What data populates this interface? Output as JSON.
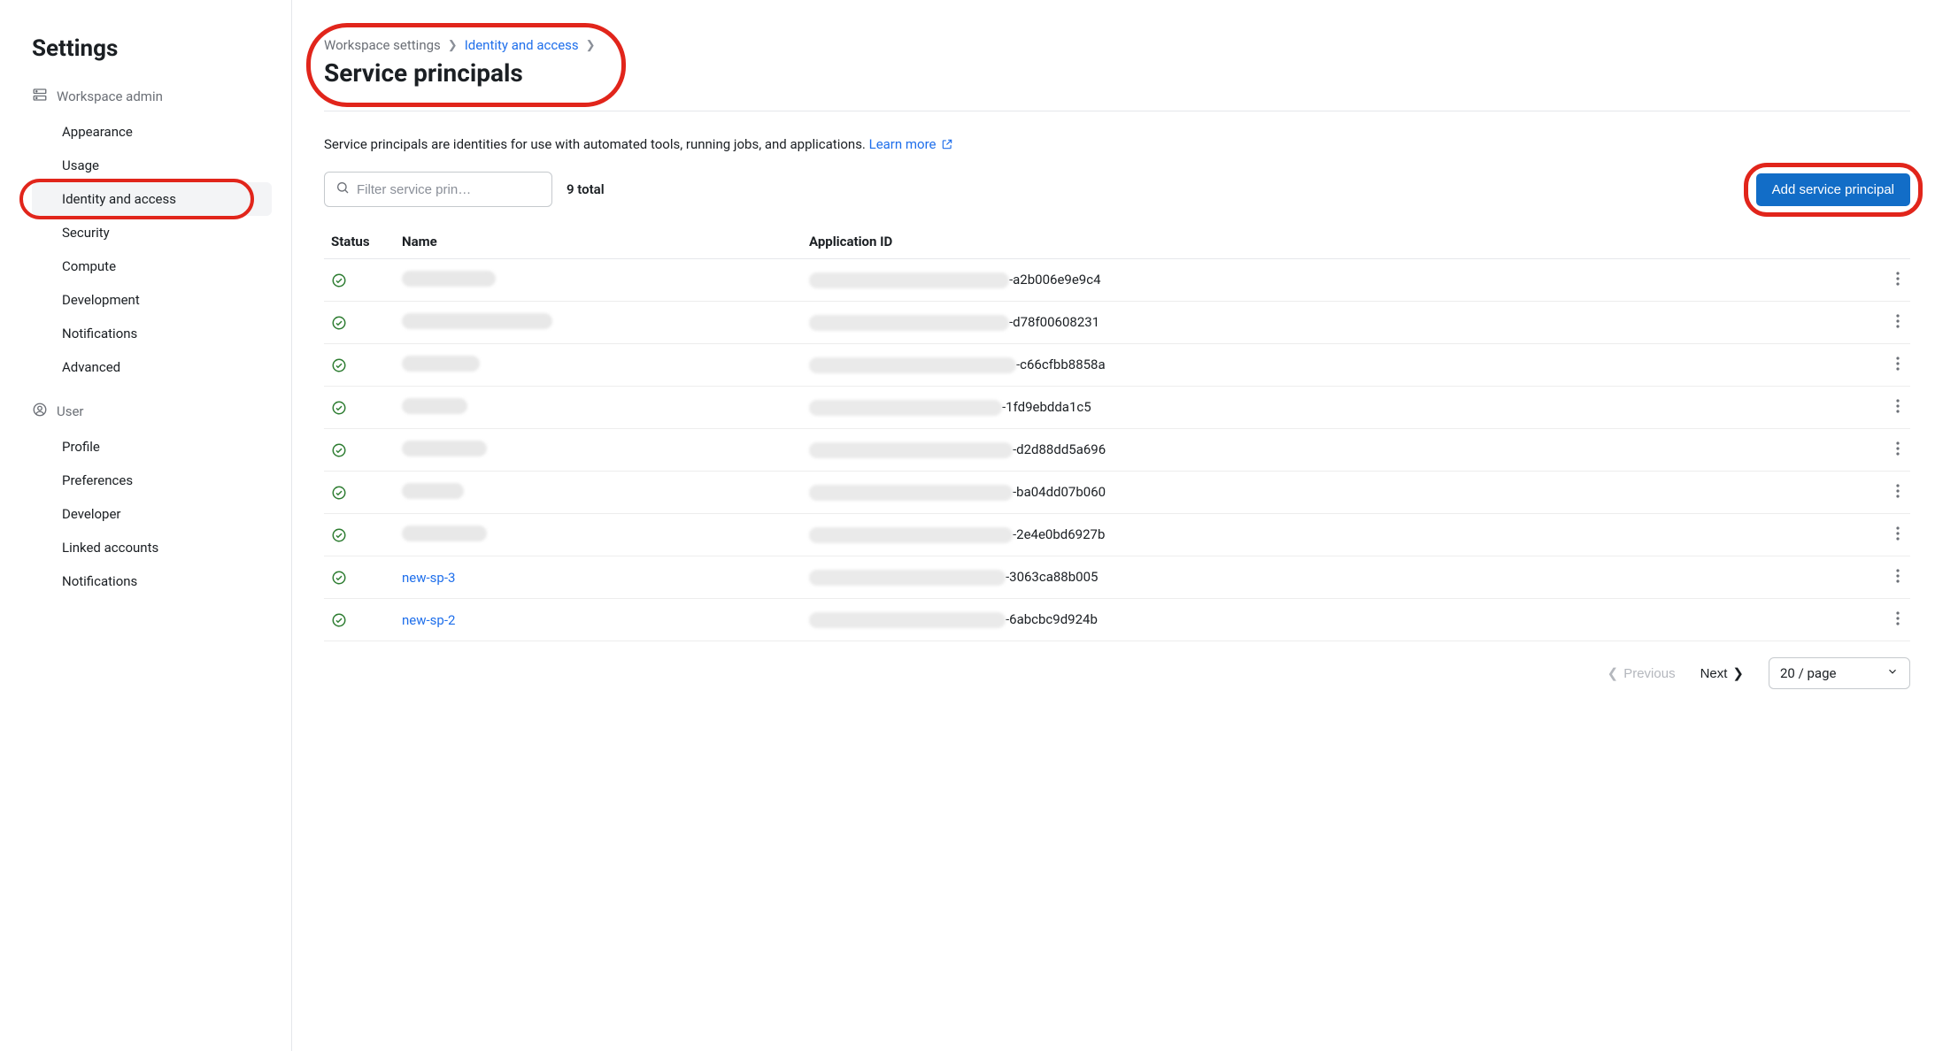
{
  "sidebar": {
    "title": "Settings",
    "sections": [
      {
        "header": "Workspace admin",
        "items": [
          {
            "label": "Appearance"
          },
          {
            "label": "Usage"
          },
          {
            "label": "Identity and access",
            "active": true,
            "highlighted": true
          },
          {
            "label": "Security"
          },
          {
            "label": "Compute"
          },
          {
            "label": "Development"
          },
          {
            "label": "Notifications"
          },
          {
            "label": "Advanced"
          }
        ]
      },
      {
        "header": "User",
        "items": [
          {
            "label": "Profile"
          },
          {
            "label": "Preferences"
          },
          {
            "label": "Developer"
          },
          {
            "label": "Linked accounts"
          },
          {
            "label": "Notifications"
          }
        ]
      }
    ]
  },
  "breadcrumb": {
    "item0": "Workspace settings",
    "item1": "Identity and access"
  },
  "page_title": "Service principals",
  "description": {
    "text": "Service principals are identities for use with automated tools, running jobs, and applications. ",
    "learn_more": "Learn more"
  },
  "filter": {
    "placeholder": "Filter service prin…"
  },
  "count_label": "9 total",
  "add_button_label": "Add service principal",
  "columns": {
    "status": "Status",
    "name": "Name",
    "appid": "Application ID"
  },
  "rows": [
    {
      "name": "",
      "name_blur_w": 106,
      "appid_blur_w": 226,
      "appid_suffix": "-a2b006e9e9c4"
    },
    {
      "name": "",
      "name_blur_w": 170,
      "appid_blur_w": 226,
      "appid_suffix": "-d78f00608231"
    },
    {
      "name": "",
      "name_blur_w": 88,
      "appid_blur_w": 234,
      "appid_suffix": "-c66cfbb8858a"
    },
    {
      "name": "",
      "name_blur_w": 74,
      "appid_blur_w": 218,
      "appid_suffix": "-1fd9ebdda1c5"
    },
    {
      "name": "",
      "name_blur_w": 96,
      "appid_blur_w": 230,
      "appid_suffix": "-d2d88dd5a696"
    },
    {
      "name": "",
      "name_blur_w": 70,
      "appid_blur_w": 230,
      "appid_suffix": "-ba04dd07b060"
    },
    {
      "name": "",
      "name_blur_w": 96,
      "appid_blur_w": 230,
      "appid_suffix": "-2e4e0bd6927b"
    },
    {
      "name": "new-sp-3",
      "name_blur_w": 0,
      "appid_blur_w": 222,
      "appid_suffix": "-3063ca88b005"
    },
    {
      "name": "new-sp-2",
      "name_blur_w": 0,
      "appid_blur_w": 222,
      "appid_suffix": "-6abcbc9d924b"
    }
  ],
  "pagination": {
    "previous": "Previous",
    "next": "Next",
    "page_size": "20 / page"
  }
}
